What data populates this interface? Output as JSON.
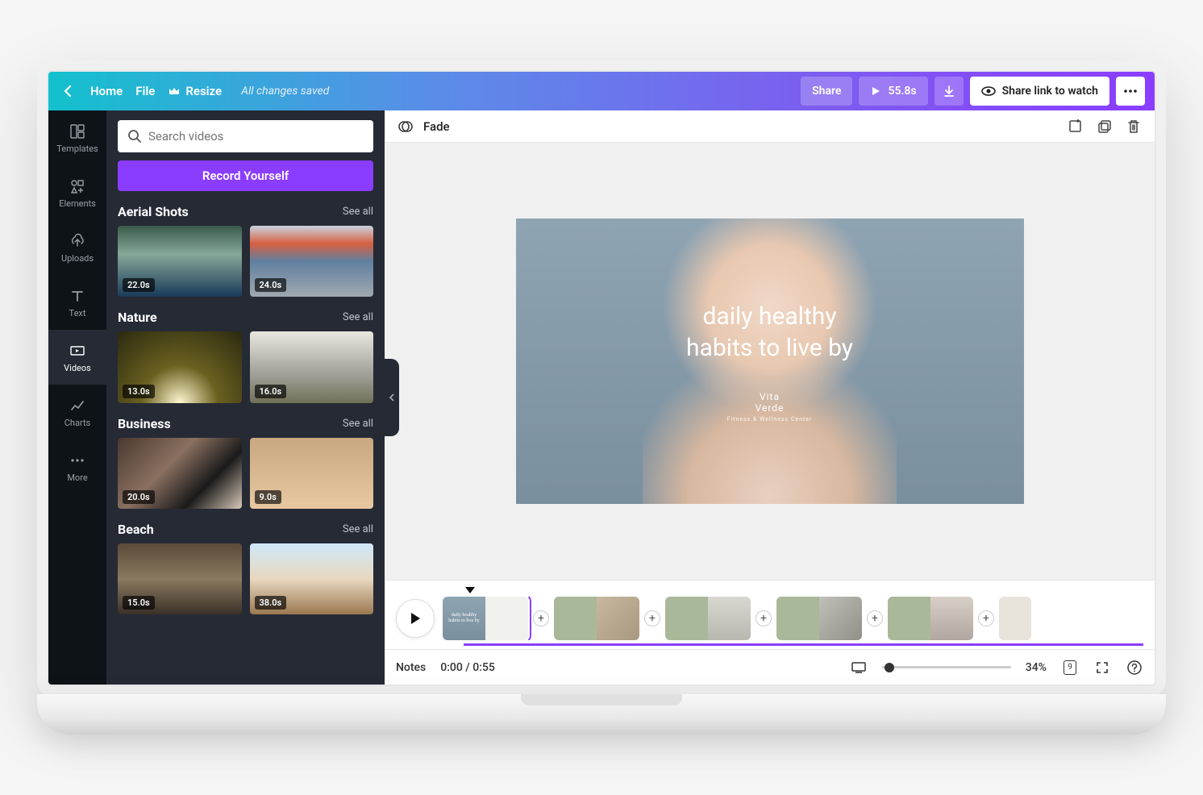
{
  "topbar": {
    "home": "Home",
    "file": "File",
    "resize": "Resize",
    "status": "All changes saved",
    "share": "Share",
    "duration": "55.8s",
    "share_link": "Share link to watch"
  },
  "nav": {
    "templates": "Templates",
    "elements": "Elements",
    "uploads": "Uploads",
    "text": "Text",
    "videos": "Videos",
    "charts": "Charts",
    "more": "More"
  },
  "panel": {
    "search_placeholder": "Search videos",
    "record": "Record Yourself",
    "see_all": "See all",
    "categories": [
      {
        "title": "Aerial Shots",
        "items": [
          {
            "dur": "22.0s",
            "bg": "bg-aerial1"
          },
          {
            "dur": "24.0s",
            "bg": "bg-aerial2"
          }
        ]
      },
      {
        "title": "Nature",
        "items": [
          {
            "dur": "13.0s",
            "bg": "bg-nature1"
          },
          {
            "dur": "16.0s",
            "bg": "bg-nature2"
          }
        ]
      },
      {
        "title": "Business",
        "items": [
          {
            "dur": "20.0s",
            "bg": "bg-biz1"
          },
          {
            "dur": "9.0s",
            "bg": "bg-biz2"
          }
        ]
      },
      {
        "title": "Beach",
        "items": [
          {
            "dur": "15.0s",
            "bg": "bg-beach1"
          },
          {
            "dur": "38.0s",
            "bg": "bg-beach2"
          }
        ]
      }
    ]
  },
  "canvas": {
    "transition": "Fade",
    "slide_heading_l1": "daily healthy",
    "slide_heading_l2": "habits to live by",
    "brand_l1": "Vita",
    "brand_l2": "Verde",
    "brand_tag": "Fitness & Wellness Center"
  },
  "bottom": {
    "notes": "Notes",
    "time": "0:00 / 0:55",
    "zoom": "34%",
    "page_count": "9"
  }
}
